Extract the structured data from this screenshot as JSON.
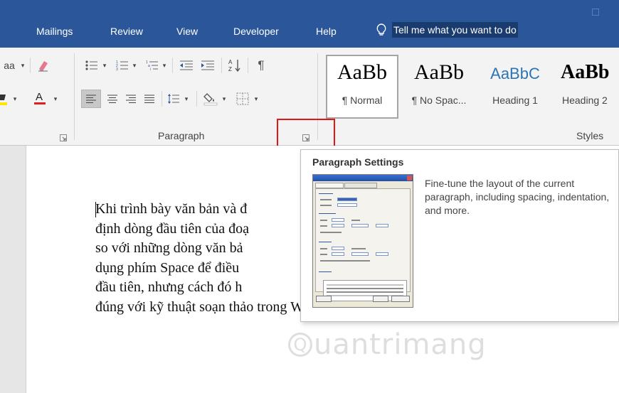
{
  "tabs": [
    "Mailings",
    "Review",
    "View",
    "Developer",
    "Help"
  ],
  "tell_me": "Tell me what you want to do",
  "ribbon": {
    "font_size_fragment": "aa",
    "paragraph_group": "Paragraph",
    "styles_group": "Styles",
    "styles": [
      {
        "sample": "AaBb",
        "name": "¶ Normal",
        "color": "#000000"
      },
      {
        "sample": "AaBb",
        "name": "¶ No Spac...",
        "color": "#000000"
      },
      {
        "sample": "AaBbC",
        "name": "Heading 1",
        "color": "#2e74b5"
      },
      {
        "sample": "AaBb",
        "name": "Heading 2",
        "color": "#000000"
      }
    ]
  },
  "document": {
    "lines": [
      "Khi trình bày văn bản và đ",
      "định dòng đầu tiên của đoạ",
      "so với những dòng văn bả",
      "dụng phím Space để điều",
      "đầu tiên, nhưng cách đó h",
      "đúng với kỹ thuật soạn thảo trong Word."
    ]
  },
  "tooltip": {
    "title": "Paragraph Settings",
    "description": "Fine-tune the layout of the current paragraph, including spacing, indentation, and more."
  },
  "watermark": {
    "text": "uantrimang",
    "symbol": "Q"
  },
  "colors": {
    "tab_bar": "#2b579a",
    "ribbon": "#f3f3f3",
    "highlight": "#e01717",
    "heading_blue": "#2e74b5"
  },
  "icons": [
    "lightbulb-icon",
    "clear-formatting-icon",
    "highlight-icon",
    "font-color-icon",
    "bullets-icon",
    "numbering-icon",
    "multilevel-list-icon",
    "decrease-indent-icon",
    "increase-indent-icon",
    "sort-icon",
    "show-paragraph-marks-icon",
    "align-left-icon",
    "center-icon",
    "align-right-icon",
    "justify-icon",
    "line-spacing-icon",
    "shading-icon",
    "borders-icon",
    "dialog-launcher-icon"
  ]
}
